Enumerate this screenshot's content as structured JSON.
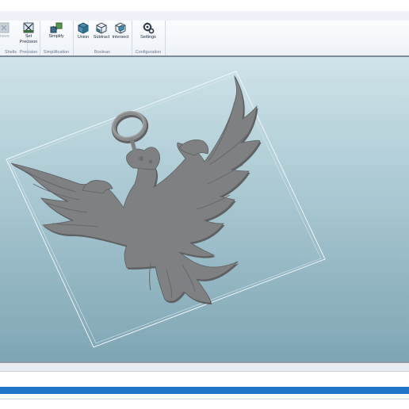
{
  "ribbon": {
    "groups": [
      {
        "label": "Shells",
        "buttons": [
          {
            "label": "move",
            "icon": "remove-shell-icon",
            "enabled": false
          }
        ]
      },
      {
        "label": "Precision",
        "buttons": [
          {
            "label": "Set\nPrecision",
            "icon": "set-precision-icon",
            "enabled": true
          }
        ]
      },
      {
        "label": "Simplification",
        "buttons": [
          {
            "label": "Simplify",
            "icon": "simplify-icon",
            "enabled": true
          }
        ]
      },
      {
        "label": "Boolean",
        "buttons": [
          {
            "label": "Union",
            "icon": "union-cube-icon",
            "enabled": true
          },
          {
            "label": "Subtract",
            "icon": "subtract-cube-icon",
            "enabled": true
          },
          {
            "label": "Intersect",
            "icon": "intersect-cube-icon",
            "enabled": true
          }
        ]
      },
      {
        "label": "Configuration",
        "buttons": [
          {
            "label": "Settings",
            "icon": "settings-gears-icon",
            "enabled": true
          }
        ]
      }
    ]
  },
  "viewport": {
    "object": "phoenix-pendant-model",
    "colors": {
      "background_top": "#cfe3e9",
      "background_bottom": "#7fa5b4",
      "model": "#7d7f80"
    }
  },
  "status": {
    "progress_fraction": 1.0,
    "progress_color": "#1f73c8"
  }
}
